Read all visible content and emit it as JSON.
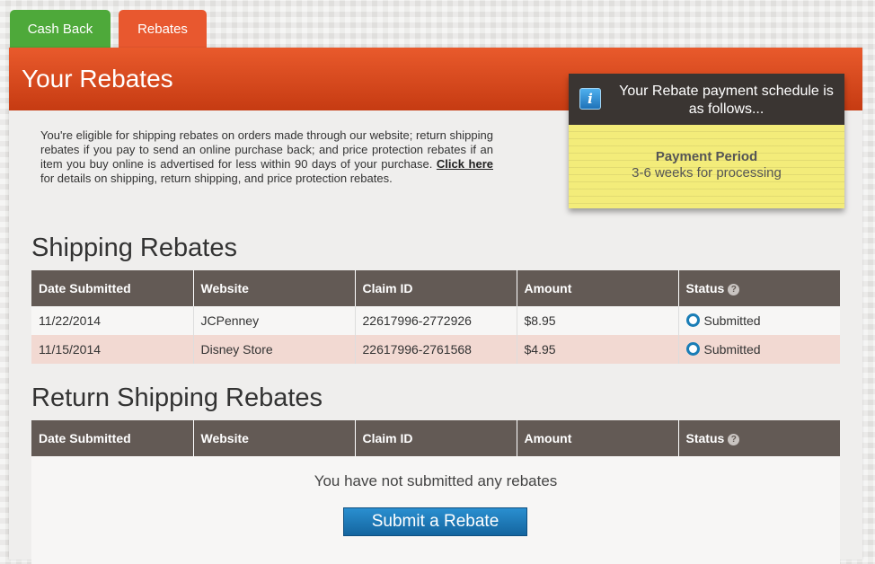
{
  "tabs": [
    {
      "label": "Cash Back"
    },
    {
      "label": "Rebates"
    }
  ],
  "banner": {
    "title": "Your Rebates"
  },
  "intro": {
    "text_before": "You're eligible for shipping rebates on orders made through our website; return shipping rebates if you pay to send an online purchase back; and price protection rebates if an item you buy online is advertised for less within 90 days of your purchase. ",
    "link_label": "Click here",
    "text_after": " for details on shipping, return shipping, and price protection rebates."
  },
  "note": {
    "header": "Your Rebate payment schedule is as follows...",
    "info_icon": "i",
    "period_label": "Payment Period",
    "period_value": "3-6 weeks for processing"
  },
  "shipping": {
    "title": "Shipping Rebates",
    "columns": [
      "Date Submitted",
      "Website",
      "Claim ID",
      "Amount",
      "Status"
    ],
    "rows": [
      {
        "date": "11/22/2014",
        "website": "JCPenney",
        "claim_id": "22617996-2772926",
        "amount": "$8.95",
        "status": "Submitted"
      },
      {
        "date": "11/15/2014",
        "website": "Disney Store",
        "claim_id": "22617996-2761568",
        "amount": "$4.95",
        "status": "Submitted"
      }
    ]
  },
  "return_shipping": {
    "title": "Return Shipping Rebates",
    "columns": [
      "Date Submitted",
      "Website",
      "Claim ID",
      "Amount",
      "Status"
    ],
    "empty_text": "You have not submitted any rebates",
    "submit_label": "Submit a Rebate"
  },
  "help_icon": "?",
  "colors": {
    "cash_back_tab": "#4ea93a",
    "rebates_tab": "#e8582f",
    "table_header": "#635a55",
    "highlight_row": "#f2d9d2",
    "note_yellow": "#f3ec7a",
    "button_blue": "#1a7db6"
  }
}
